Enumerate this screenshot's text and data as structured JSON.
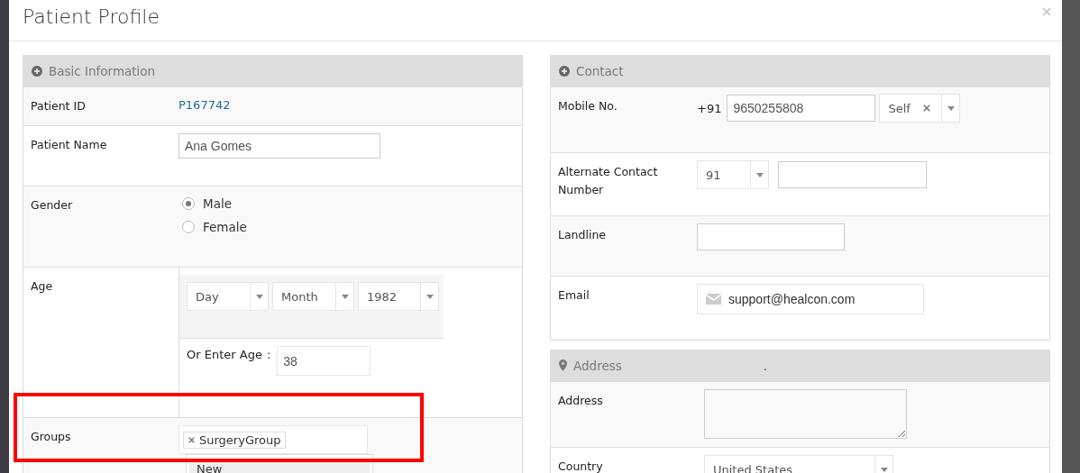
{
  "modal": {
    "title": "Patient Profile"
  },
  "basic_information": {
    "title": "Basic Information",
    "kind": "expandable",
    "rows": [
      {
        "kind": "link",
        "label": "Patient ID",
        "value": "P167742"
      },
      {
        "kind": "input",
        "label": "Patient Name",
        "value": "Ana Gomes"
      },
      {
        "kind": "radio",
        "label": "Gender",
        "options": [
          {
            "label": "Male",
            "selected": true
          },
          {
            "label": "Female",
            "selected": false
          }
        ]
      },
      {
        "kind": "age",
        "label": "Age",
        "selects": [
          "Day",
          "Month",
          "1982"
        ],
        "age_label": "Or Enter Age",
        "separator": ":",
        "age_value": "38"
      },
      {
        "kind": "tags",
        "label": "Groups",
        "tags": [
          "SurgeryGroup"
        ],
        "options": [
          {
            "label": "New",
            "selected": true
          }
        ]
      }
    ]
  },
  "contact": {
    "title": "Contact",
    "kind": "expandable",
    "rows": [
      {
        "kind": "mobile",
        "label": "Mobile No.",
        "prefix": "+91",
        "value": "9650255808",
        "relation": "Self"
      },
      {
        "kind": "alt_phone",
        "label": "Alternate Contact Number",
        "code": "91"
      },
      {
        "kind": "input",
        "label": "Landline"
      },
      {
        "kind": "email",
        "label": "Email",
        "value": "support@healcon.com"
      }
    ]
  },
  "address": {
    "title": "Address",
    "kind": "location",
    "note": ".",
    "rows": [
      {
        "kind": "textarea",
        "label": "Address"
      },
      {
        "kind": "select",
        "label": "Country",
        "value": "United States"
      }
    ]
  },
  "highlight": {
    "on": true
  }
}
